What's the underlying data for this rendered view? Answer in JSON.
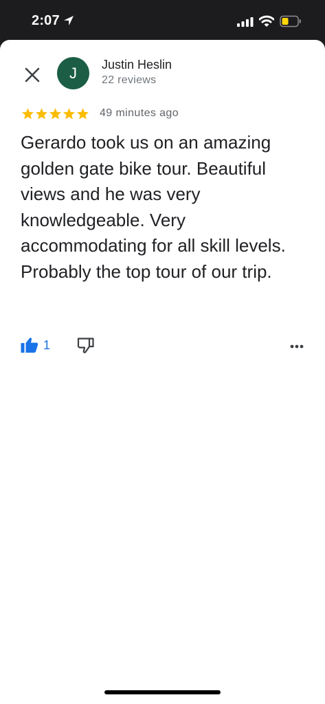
{
  "status_bar": {
    "time": "2:07"
  },
  "review": {
    "reviewer_name": "Justin Heslin",
    "reviewer_initial": "J",
    "review_count": "22 reviews",
    "rating": 5,
    "timestamp": "49 minutes ago",
    "text": "Gerardo took us on an amazing golden gate bike tour. Beautiful views and he was very knowledgeable. Very accommodating for all skill levels. Probably the top tour of our trip.",
    "like_count": "1"
  },
  "colors": {
    "avatar_bg": "#1b5e45",
    "star": "#fbbc04",
    "accent": "#1a73e8",
    "battery": "#ffd60a"
  },
  "icons": {
    "close": "close-icon",
    "like": "thumbs-up-icon",
    "dislike": "thumbs-down-icon",
    "more": "more-horizontal-icon"
  }
}
